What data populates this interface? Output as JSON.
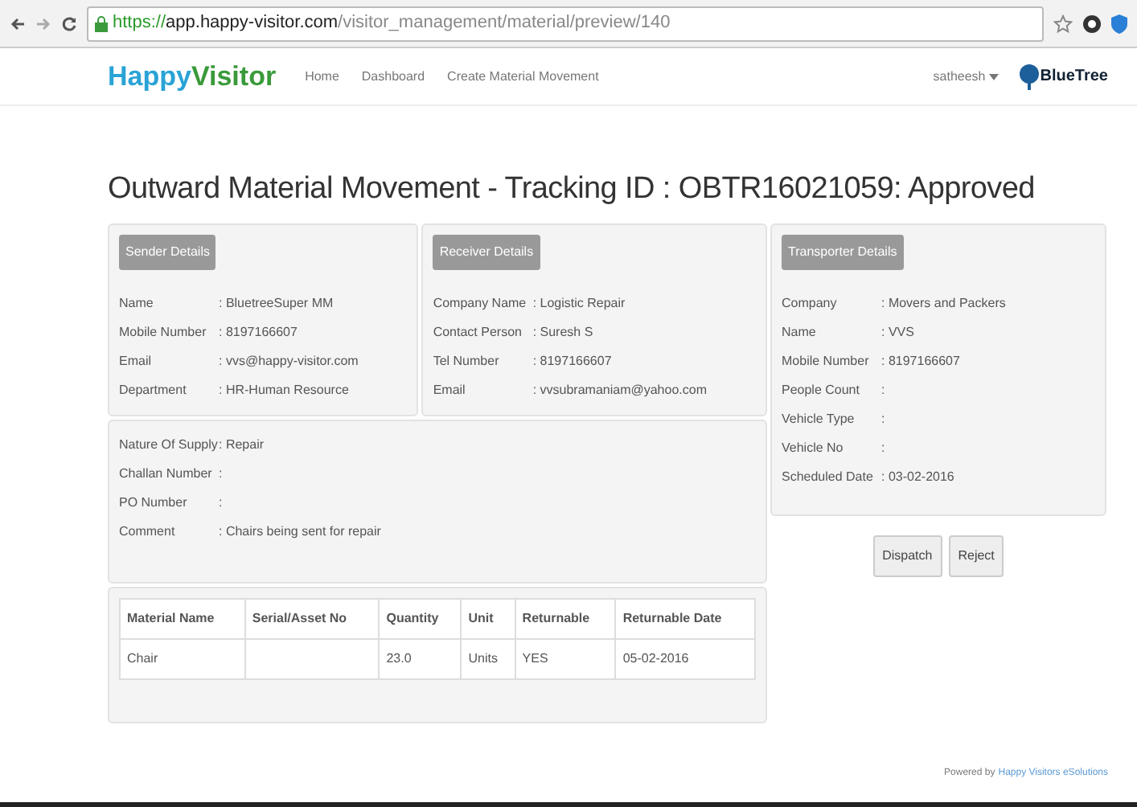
{
  "browser": {
    "url": {
      "scheme": "https://",
      "host": "app.happy-visitor.com",
      "path": "/visitor_management/material/preview/140"
    }
  },
  "navbar": {
    "logo": {
      "part1": "Happy",
      "part2": "Visitor"
    },
    "links": [
      "Home",
      "Dashboard",
      "Create Material Movement"
    ],
    "user": "satheesh",
    "partner_logo": "BlueTree"
  },
  "title": "Outward Material Movement - Tracking ID : OBTR16021059: Approved",
  "sender": {
    "heading": "Sender Details",
    "fields": [
      {
        "label": "Name",
        "value": ": BluetreeSuper MM"
      },
      {
        "label": "Mobile Number",
        "value": ": 8197166607"
      },
      {
        "label": "Email",
        "value": ": vvs@happy-visitor.com"
      },
      {
        "label": "Department",
        "value": ": HR-Human Resource"
      }
    ]
  },
  "receiver": {
    "heading": "Receiver Details",
    "fields": [
      {
        "label": "Company Name",
        "value": ": Logistic Repair"
      },
      {
        "label": "Contact Person",
        "value": ": Suresh S"
      },
      {
        "label": "Tel Number",
        "value": ": 8197166607"
      },
      {
        "label": "Email",
        "value": ": vvsubramaniam@yahoo.com"
      }
    ]
  },
  "supply": {
    "fields": [
      {
        "label": "Nature Of Supply",
        "value": ": Repair"
      },
      {
        "label": "Challan Number",
        "value": ":"
      },
      {
        "label": "PO Number",
        "value": ":"
      },
      {
        "label": "Comment",
        "value": ": Chairs being sent for repair"
      }
    ]
  },
  "table": {
    "columns": [
      "Material Name",
      "Serial/Asset No",
      "Quantity",
      "Unit",
      "Returnable",
      "Returnable Date"
    ],
    "rows": [
      [
        "Chair",
        "",
        "23.0",
        "Units",
        "YES",
        "05-02-2016"
      ]
    ]
  },
  "transporter": {
    "heading": "Transporter Details",
    "fields": [
      {
        "label": "Company",
        "value": ": Movers and Packers"
      },
      {
        "label": "Name",
        "value": ": VVS"
      },
      {
        "label": "Mobile Number",
        "value": ": 8197166607"
      },
      {
        "label": "People Count",
        "value": ":"
      },
      {
        "label": "Vehicle Type",
        "value": ":"
      },
      {
        "label": "Vehicle No",
        "value": ":"
      },
      {
        "label": "Scheduled Date",
        "value": ": 03-02-2016"
      }
    ]
  },
  "buttons": [
    "Dispatch",
    "Reject"
  ],
  "footer": {
    "prefix": "Powered by",
    "link": "Happy Visitors eSolutions"
  }
}
